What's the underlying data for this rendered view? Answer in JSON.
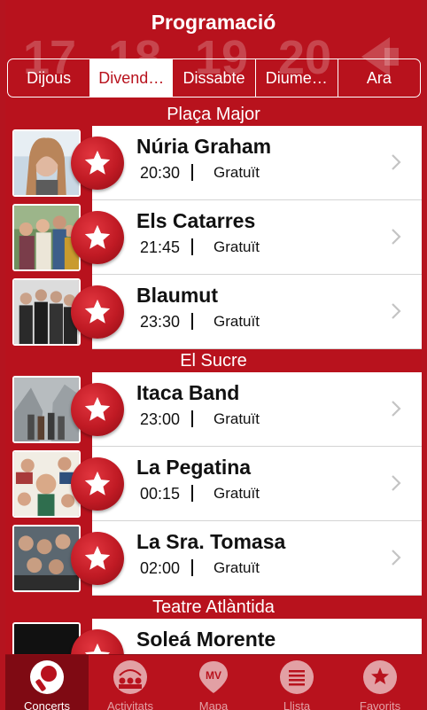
{
  "header": {
    "title": "Programació",
    "background_dates": [
      "17",
      "18",
      "19",
      "20"
    ]
  },
  "day_tabs": [
    {
      "label": "Dijous",
      "active": false
    },
    {
      "label": "Divend…",
      "active": true
    },
    {
      "label": "Dissabte",
      "active": false
    },
    {
      "label": "Diume…",
      "active": false
    },
    {
      "label": "Ara",
      "active": false
    }
  ],
  "sections": [
    {
      "title": "Plaça Major",
      "concerts": [
        {
          "name": "Núria Graham",
          "time": "20:30",
          "price": "Gratuït"
        },
        {
          "name": "Els Catarres",
          "time": "21:45",
          "price": "Gratuït"
        },
        {
          "name": "Blaumut",
          "time": "23:30",
          "price": "Gratuït"
        }
      ]
    },
    {
      "title": "El Sucre",
      "concerts": [
        {
          "name": "Itaca Band",
          "time": "23:00",
          "price": "Gratuït"
        },
        {
          "name": "La Pegatina",
          "time": "00:15",
          "price": "Gratuït"
        },
        {
          "name": "La Sra. Tomasa",
          "time": "02:00",
          "price": "Gratuït"
        }
      ]
    },
    {
      "title": "Teatre Atlàntida",
      "concerts": [
        {
          "name": "Soleá Morente",
          "time": "",
          "price": ""
        }
      ]
    }
  ],
  "tabbar": [
    {
      "label": "Concerts",
      "icon": "microphone-icon",
      "active": true
    },
    {
      "label": "Activitats",
      "icon": "audience-icon",
      "active": false
    },
    {
      "label": "Mapa",
      "icon": "map-mv-icon",
      "active": false
    },
    {
      "label": "Llista",
      "icon": "list-icon",
      "active": false
    },
    {
      "label": "Favorits",
      "icon": "star-icon",
      "active": false
    }
  ],
  "colors": {
    "brand_red": "#b8121d",
    "active_tab_dark": "#7f0a13"
  }
}
